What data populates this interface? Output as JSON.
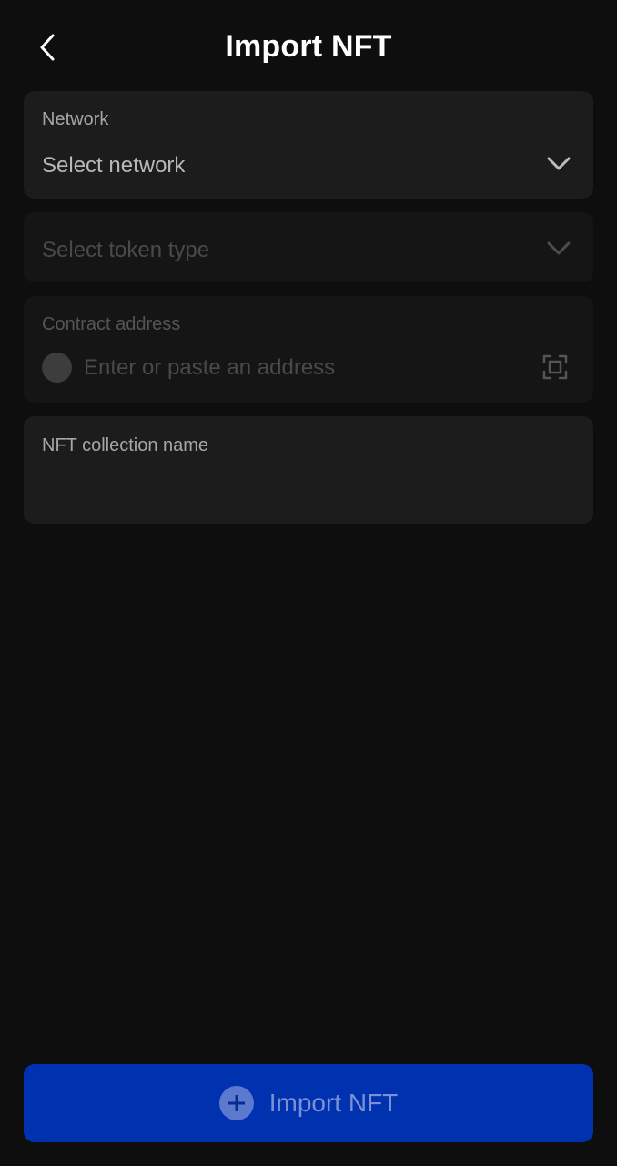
{
  "header": {
    "title": "Import NFT",
    "back_icon": "chevron-left-icon"
  },
  "form": {
    "network": {
      "label": "Network",
      "value": "Select network",
      "icon": "chevron-down-icon"
    },
    "token_type": {
      "value": "Select token type",
      "icon": "chevron-down-icon"
    },
    "contract_address": {
      "label": "Contract address",
      "placeholder": "Enter or paste an address",
      "value": "",
      "scan_icon": "scan-icon"
    },
    "collection_name": {
      "label": "NFT collection name",
      "value": ""
    }
  },
  "footer": {
    "import_label": "Import NFT",
    "import_icon": "plus-circle-icon"
  },
  "colors": {
    "background": "#0e0e0e",
    "card": "#1c1c1c",
    "card_disabled": "#151515",
    "button": "#0032b0"
  }
}
